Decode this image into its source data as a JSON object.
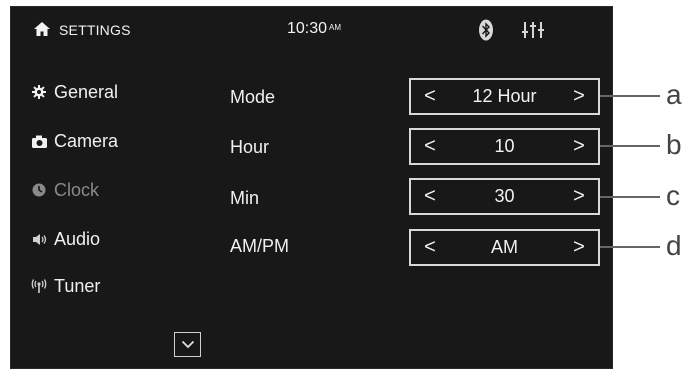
{
  "header": {
    "icon": "home-icon",
    "title": "SETTINGS",
    "time": "10:30",
    "time_suffix": "AM",
    "right_icons": [
      "bluetooth-icon",
      "equalizer-icon"
    ]
  },
  "sidebar": {
    "items": [
      {
        "label": "General",
        "icon": "gear-icon",
        "active": false
      },
      {
        "label": "Camera",
        "icon": "camera-icon",
        "active": false
      },
      {
        "label": "Clock",
        "icon": "clock-icon",
        "active": true
      },
      {
        "label": "Audio",
        "icon": "speaker-icon",
        "active": false
      },
      {
        "label": "Tuner",
        "icon": "antenna-icon",
        "active": false
      }
    ],
    "scroll_icon": "chevron-down-icon"
  },
  "settings": [
    {
      "label": "Mode",
      "value": "12 Hour",
      "callout": "a"
    },
    {
      "label": "Hour",
      "value": "10",
      "callout": "b"
    },
    {
      "label": "Min",
      "value": "30",
      "callout": "c"
    },
    {
      "label": "AM/PM",
      "value": "AM",
      "callout": "d"
    }
  ],
  "arrows": {
    "left": "<",
    "right": ">"
  },
  "colors": {
    "screen_background": "#181818",
    "text": "#f0f0f0",
    "inactive_text": "#8a8a8a",
    "stepper_border": "#d9d9d9"
  }
}
